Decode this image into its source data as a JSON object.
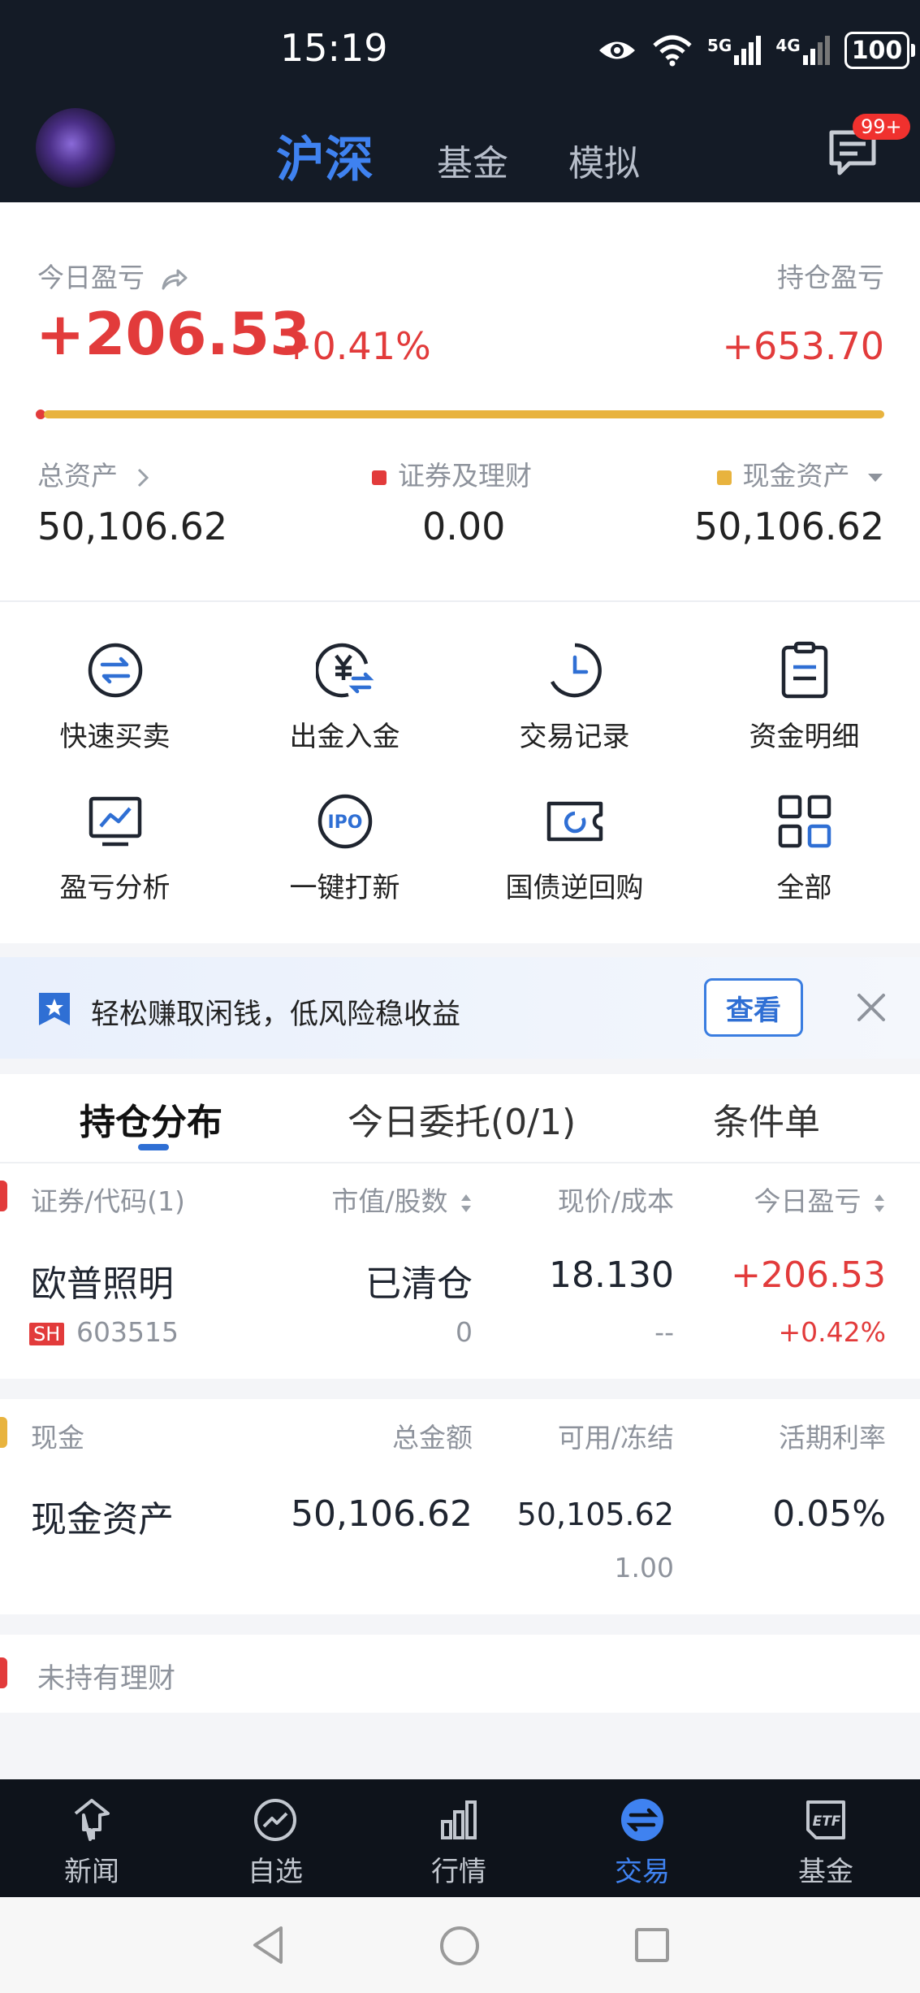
{
  "status_bar": {
    "time": "15:19",
    "network_5g": "5G",
    "network_4g": "4G",
    "battery": "100"
  },
  "header": {
    "tabs": [
      {
        "label": "沪深",
        "active": true
      },
      {
        "label": "基金",
        "active": false
      },
      {
        "label": "模拟",
        "active": false
      }
    ],
    "message_badge": "99+"
  },
  "summary": {
    "today_pl_label": "今日盈亏",
    "today_pl_value": "+206.53",
    "today_pl_pct": "+0.41%",
    "hold_pl_label": "持仓盈亏",
    "hold_pl_value": "+653.70",
    "progress_fraction": 0.99,
    "total_assets_label": "总资产",
    "total_assets_value": "50,106.62",
    "securities_label": "证券及理财",
    "securities_value": "0.00",
    "cash_label": "现金资产",
    "cash_value": "50,106.62"
  },
  "quick_actions": [
    {
      "label": "快速买卖",
      "icon": "swap-arrows-icon"
    },
    {
      "label": "出金入金",
      "icon": "yuan-transfer-icon"
    },
    {
      "label": "交易记录",
      "icon": "clock-icon"
    },
    {
      "label": "资金明细",
      "icon": "clipboard-icon"
    },
    {
      "label": "盈亏分析",
      "icon": "chart-monitor-icon"
    },
    {
      "label": "一键打新",
      "icon": "ipo-icon"
    },
    {
      "label": "国债逆回购",
      "icon": "bond-ticket-icon"
    },
    {
      "label": "全部",
      "icon": "grid-icon"
    }
  ],
  "promo": {
    "text": "轻松赚取闲钱，低风险稳收益",
    "button": "查看"
  },
  "section_tabs": [
    {
      "label": "持仓分布",
      "active": true
    },
    {
      "label": "今日委托(0/1)",
      "active": false
    },
    {
      "label": "条件单",
      "active": false
    }
  ],
  "positions": {
    "headers": [
      "证券/代码(1)",
      "市值/股数",
      "现价/成本",
      "今日盈亏"
    ],
    "rows": [
      {
        "name": "欧普照明",
        "market": "SH",
        "code": "603515",
        "market_value": "已清仓",
        "shares": "0",
        "price": "18.130",
        "cost": "--",
        "today_pl": "+206.53",
        "today_pl_pct": "+0.42%"
      }
    ]
  },
  "cash": {
    "headers": [
      "现金",
      "总金额",
      "可用/冻结",
      "活期利率"
    ],
    "rows": [
      {
        "name": "现金资产",
        "total": "50,106.62",
        "available": "50,105.62",
        "frozen": "1.00",
        "rate": "0.05%"
      }
    ]
  },
  "wealth": {
    "label": "未持有理财"
  },
  "bottom_nav": [
    {
      "label": "新闻",
      "icon": "news-icon",
      "active": false
    },
    {
      "label": "自选",
      "icon": "trend-circle-icon",
      "active": false
    },
    {
      "label": "行情",
      "icon": "bar-chart-icon",
      "active": false
    },
    {
      "label": "交易",
      "icon": "exchange-icon",
      "active": true
    },
    {
      "label": "基金",
      "icon": "etf-icon",
      "active": false
    }
  ],
  "colors": {
    "accent": "#3f82f0",
    "gain": "#e23b3b",
    "progress": "#e8b33e",
    "header_bg": "#141b26"
  }
}
